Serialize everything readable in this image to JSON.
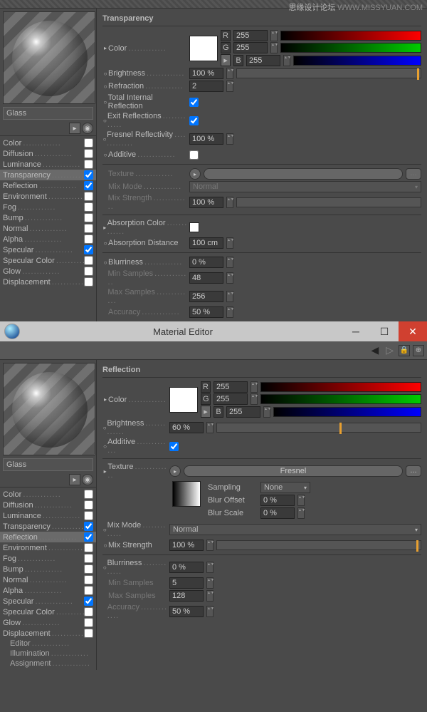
{
  "watermark_site": "思缘设计论坛",
  "watermark_url": "WWW.MISSYUAN.COM",
  "material_name": "Glass",
  "window_title": "Material Editor",
  "channels": [
    "Color",
    "Diffusion",
    "Luminance",
    "Transparency",
    "Reflection",
    "Environment",
    "Fog",
    "Bump",
    "Normal",
    "Alpha",
    "Specular",
    "Specular Color",
    "Glow",
    "Displacement"
  ],
  "extra_channels": [
    "Editor",
    "Illumination",
    "Assignment"
  ],
  "checked_top": {
    "Transparency": true,
    "Reflection": true,
    "Specular": true
  },
  "checked_bot": {
    "Transparency": true,
    "Reflection": true,
    "Specular": true
  },
  "selected_top": "Transparency",
  "selected_bot": "Reflection",
  "top": {
    "header": "Transparency",
    "color_r": "255",
    "color_g": "255",
    "color_b": "255",
    "brightness": "100 %",
    "brightness_pct": 98,
    "refraction": "2",
    "total_internal": true,
    "exit_refl": true,
    "fresnel": "100 %",
    "additive": false,
    "texture": "",
    "mix_mode": "Normal",
    "mix_strength": "100 %",
    "absorb_dist": "100 cm",
    "blur": "0 %",
    "min_samp": "48",
    "max_samp": "256",
    "accuracy": "50 %",
    "labels": {
      "color": "Color",
      "brightness": "Brightness",
      "refraction": "Refraction",
      "tir": "Total Internal Reflection",
      "exit": "Exit Reflections",
      "fresnel": "Fresnel Reflectivity",
      "additive": "Additive",
      "texture": "Texture",
      "mixmode": "Mix Mode",
      "mixstr": "Mix Strength",
      "abscolor": "Absorption Color",
      "absdist": "Absorption Distance",
      "blur": "Blurriness",
      "mins": "Min Samples",
      "maxs": "Max Samples",
      "acc": "Accuracy"
    }
  },
  "bot": {
    "header": "Reflection",
    "color_r": "255",
    "color_g": "255",
    "color_b": "255",
    "brightness": "60 %",
    "brightness_pct": 60,
    "additive": true,
    "texture": "Fresnel",
    "sampling": "None",
    "blur_off": "0 %",
    "blur_scale": "0 %",
    "mix_mode": "Normal",
    "mix_strength": "100 %",
    "mix_pct": 100,
    "blur": "0 %",
    "min_samp": "5",
    "max_samp": "128",
    "accuracy": "50 %",
    "labels": {
      "color": "Color",
      "brightness": "Brightness",
      "additive": "Additive",
      "texture": "Texture",
      "sampling": "Sampling",
      "bluroff": "Blur Offset",
      "blurscale": "Blur Scale",
      "mixmode": "Mix Mode",
      "mixstr": "Mix Strength",
      "blur": "Blurriness",
      "mins": "Min Samples",
      "maxs": "Max Samples",
      "acc": "Accuracy"
    }
  }
}
